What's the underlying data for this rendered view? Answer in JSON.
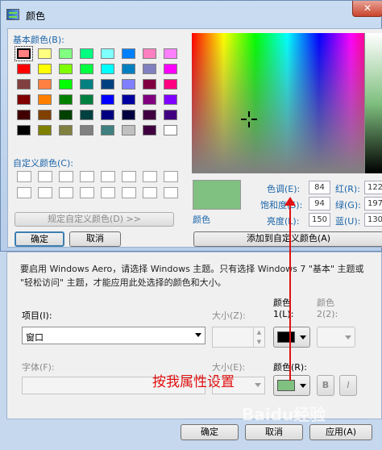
{
  "dialog": {
    "title": "颜色",
    "close_glyph": "✕",
    "basic_colors_label": "基本颜色(B):",
    "basic_colors": [
      [
        "#ff8080",
        "#ffff80",
        "#80ff80",
        "#00ff80",
        "#80ffff",
        "#0080ff",
        "#ff80c0",
        "#ff80ff"
      ],
      [
        "#ff0000",
        "#ffff00",
        "#80ff00",
        "#00ff40",
        "#00ffff",
        "#0080c0",
        "#8080c0",
        "#ff00ff"
      ],
      [
        "#804040",
        "#ff8040",
        "#00ff00",
        "#008080",
        "#004080",
        "#8080ff",
        "#800040",
        "#ff0080"
      ],
      [
        "#800000",
        "#ff8000",
        "#008000",
        "#008040",
        "#0000ff",
        "#0000a0",
        "#800080",
        "#8000ff"
      ],
      [
        "#400000",
        "#804000",
        "#004000",
        "#004040",
        "#000080",
        "#000040",
        "#400040",
        "#400080"
      ],
      [
        "#000000",
        "#808000",
        "#808040",
        "#808080",
        "#408080",
        "#c0c0c0",
        "#400040",
        "#ffffff"
      ]
    ],
    "custom_colors_label": "自定义颜色(C):",
    "define_custom_button": "规定自定义颜色(D) >>",
    "ok_button": "确定",
    "cancel_button": "取消",
    "preview_label": "颜色",
    "preview_color": "#80c080",
    "hue_label": "色调(E):",
    "hue_value": "84",
    "sat_label": "饱和度(S):",
    "sat_value": "94",
    "lum_label": "亮度(L):",
    "lum_value": "150",
    "red_label": "红(R):",
    "red_value": "122",
    "green_label": "绿(G):",
    "green_value": "197",
    "blue_label": "蓝(U):",
    "blue_value": "130",
    "add_custom_button": "添加到自定义颜色(A)"
  },
  "behind": {
    "notice": "要启用 Windows Aero，请选择 Windows 主题。只有选择 Windows 7 \"基本\" 主题或 \"轻松访问\" 主题，才能应用此处选择的颜色和大小。",
    "item_label": "项目(I):",
    "item_value": "窗口",
    "size1_label": "大小(Z):",
    "color1_label_top": "颜色",
    "color1_label_bottom": "1(L):",
    "color2_label_top": "颜色",
    "color2_label_bottom": "2(2):",
    "color1_swatch": "#000000",
    "font_label": "字体(F):",
    "size2_label": "大小(E):",
    "color_r_label": "颜色(R):",
    "color_r_swatch": "#80c080",
    "bold_button": "B",
    "italic_button": "I",
    "ok_button": "确定",
    "cancel_button": "取消",
    "apply_button": "应用(A)"
  },
  "annotation": {
    "text": "按我属性设置",
    "color": "#e01010"
  },
  "watermark": "Baidu经验"
}
